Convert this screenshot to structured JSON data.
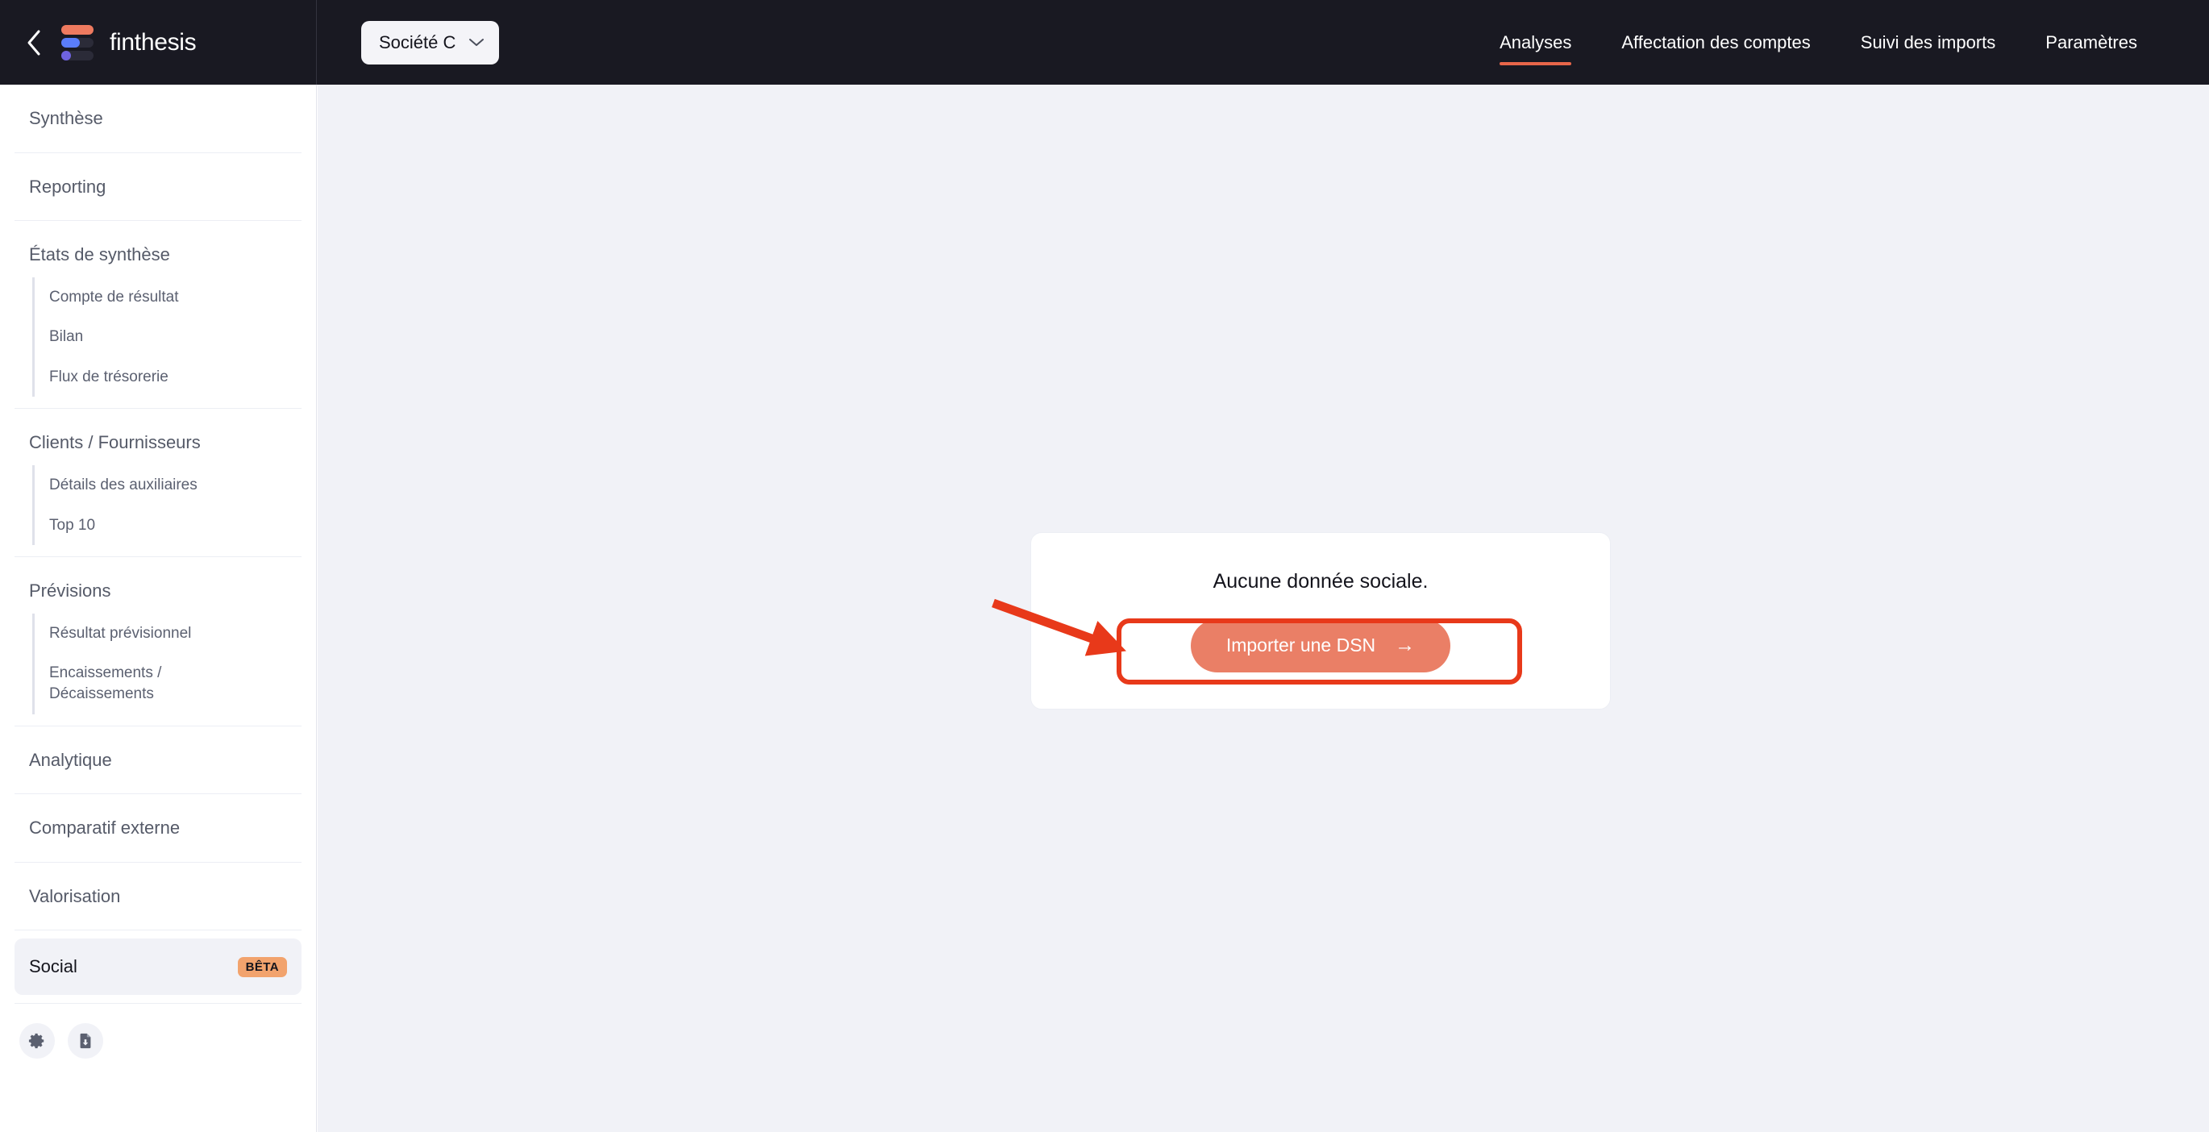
{
  "brand": {
    "name": "finthesis",
    "back_icon": "chevron-left-icon",
    "logo_icon": "finthesis-logo-icon",
    "accent_color": "#e8664a",
    "logo_bar_colors": [
      "#ee7a5f",
      "#5a7dfa",
      "#6f63e0"
    ]
  },
  "company_selector": {
    "value": "Société C",
    "chevron_icon": "chevron-down-icon"
  },
  "topnav": {
    "items": [
      {
        "label": "Analyses",
        "active": true
      },
      {
        "label": "Affectation des comptes",
        "active": false
      },
      {
        "label": "Suivi des imports",
        "active": false
      },
      {
        "label": "Paramètres",
        "active": false
      }
    ]
  },
  "sidebar": {
    "groups": [
      {
        "title": "Synthèse",
        "children": []
      },
      {
        "title": "Reporting",
        "children": []
      },
      {
        "title": "États de synthèse",
        "children": [
          "Compte de résultat",
          "Bilan",
          "Flux de trésorerie"
        ]
      },
      {
        "title": "Clients / Fournisseurs",
        "children": [
          "Détails des auxiliaires",
          "Top 10"
        ]
      },
      {
        "title": "Prévisions",
        "children": [
          "Résultat prévisionnel",
          "Encaissements / Décaissements"
        ]
      },
      {
        "title": "Analytique",
        "children": []
      },
      {
        "title": "Comparatif externe",
        "children": []
      },
      {
        "title": "Valorisation",
        "children": []
      }
    ],
    "selected_item": {
      "label": "Social",
      "badge": "BÊTA",
      "badge_color": "#f2a36d",
      "selected": true
    },
    "footer_buttons": [
      {
        "icon": "gear-icon",
        "name": "settings-button"
      },
      {
        "icon": "file-download-icon",
        "name": "export-button"
      }
    ]
  },
  "main": {
    "empty_state": {
      "message": "Aucune donnée sociale.",
      "button_label": "Importer une DSN",
      "button_arrow": "arrow-right-icon",
      "button_color": "#ea7f66"
    }
  },
  "annotation": {
    "highlight_color": "#e8391a",
    "arrow_icon": "annotation-arrow-icon",
    "target": "Importer une DSN"
  }
}
